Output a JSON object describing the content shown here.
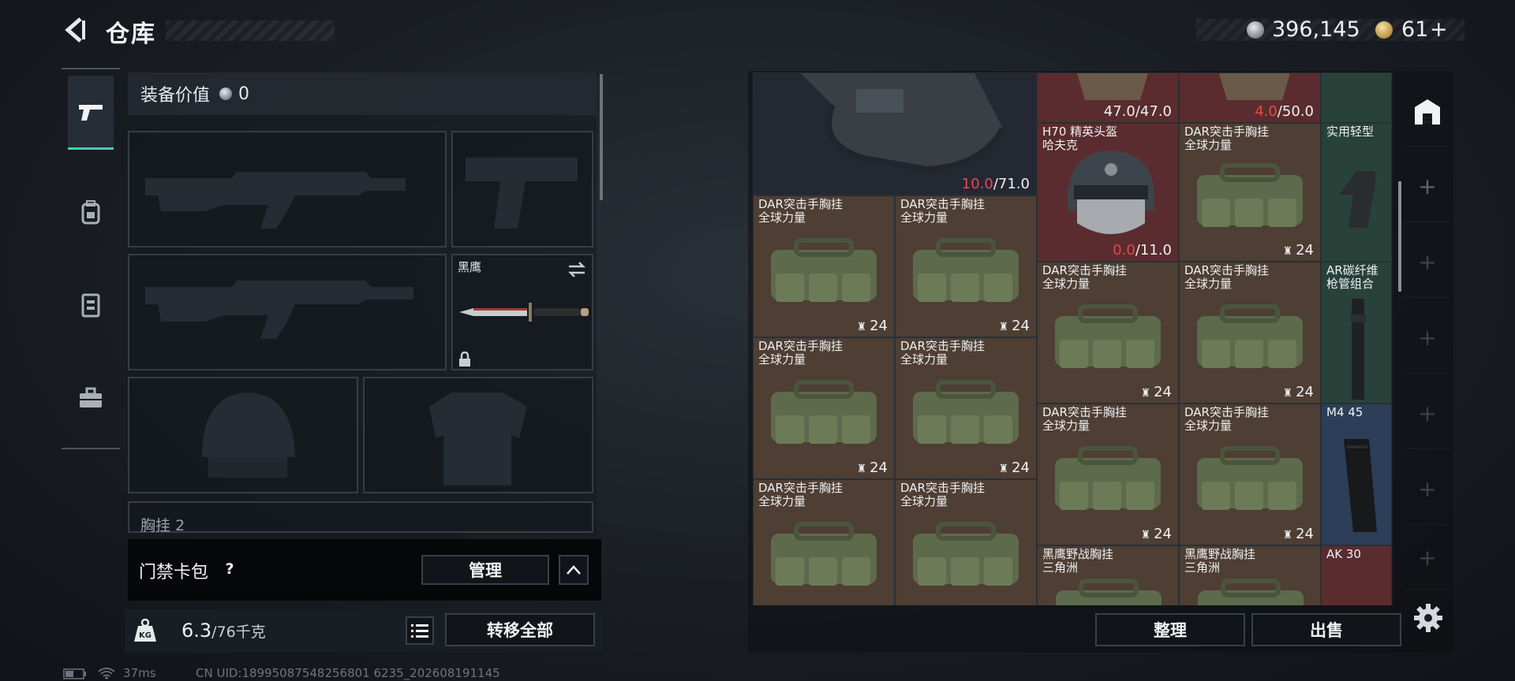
{
  "header": {
    "back_label": "back",
    "title": "仓库"
  },
  "currency": {
    "silver_amount": "396,145",
    "gold_amount": "61",
    "gold_add": "+"
  },
  "tabs": [
    {
      "name": "weapons",
      "icon": "pistol-icon",
      "active": true
    },
    {
      "name": "backpack",
      "icon": "backpack-icon",
      "active": false
    },
    {
      "name": "vest",
      "icon": "vest-icon",
      "active": false
    },
    {
      "name": "case",
      "icon": "briefcase-icon",
      "active": false
    }
  ],
  "equipment": {
    "value_label": "装备价值",
    "value_amount": "0",
    "melee_label": "黑鹰",
    "chest_label": "胸挂",
    "chest_count": "2"
  },
  "keycard": {
    "label": "门禁卡包",
    "help": "?",
    "manage_label": "管理"
  },
  "weight": {
    "current": "6.3",
    "max": "/76千克",
    "transfer_label": "转移全部"
  },
  "status": {
    "ping": "37ms",
    "uid": "CN UID:18995087548256801 6235_202608191145"
  },
  "storage": {
    "top_row": [
      {
        "value": "47.0",
        "max": "/47.0"
      },
      {
        "value": "4.0",
        "max": "/50.0"
      }
    ],
    "large_item": {
      "value": "10.0",
      "max": "/71.0"
    },
    "helmet": {
      "name": "H70 精英头盔\n哈夫克",
      "value": "0.0",
      "max": "/11.0"
    },
    "bag_name": "DAR突击手胸挂\n全球力量",
    "bag_count": "24",
    "field_vest_name": "黑鹰野战胸挂\n三角洲",
    "side_items": [
      {
        "name": "实用轻型"
      },
      {
        "name": "AR碳纤维\n枪管组合"
      },
      {
        "name": "M4 45"
      },
      {
        "name": "AK 30"
      }
    ]
  },
  "actions": {
    "sort_label": "整理",
    "sell_label": "出售"
  },
  "colors": {
    "accent": "#3fd1b0",
    "durability_red": "#e24b4b",
    "bag_cell": "#4e3e33",
    "helmet_cell": "#5a2c2f",
    "mag_cell": "#2c3e58"
  }
}
